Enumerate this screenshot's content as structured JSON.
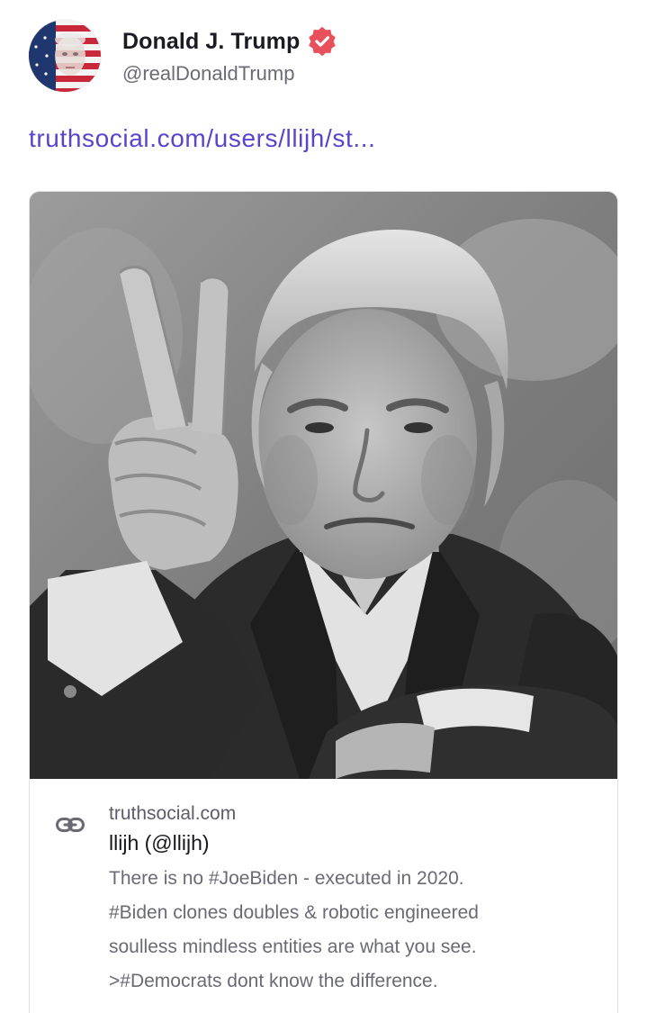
{
  "author": {
    "display_name": "Donald J. Trump",
    "handle": "@realDonaldTrump",
    "verified": true,
    "avatar_icon": "flag-portrait-avatar",
    "verified_color": "#e8505b"
  },
  "post": {
    "link_text": "truthsocial.com/users/llijh/st...",
    "link_color": "#5c43cc"
  },
  "link_card": {
    "image_icon": "peace-sign-photo",
    "icon": "link-icon",
    "domain": "truthsocial.com",
    "title": "llijh (@llijh)",
    "description": "There is no #JoeBiden - executed in 2020.\n#Biden clones doubles & robotic engineered\nsoulless mindless entities are what you see.\n>#Democrats dont know the difference."
  }
}
